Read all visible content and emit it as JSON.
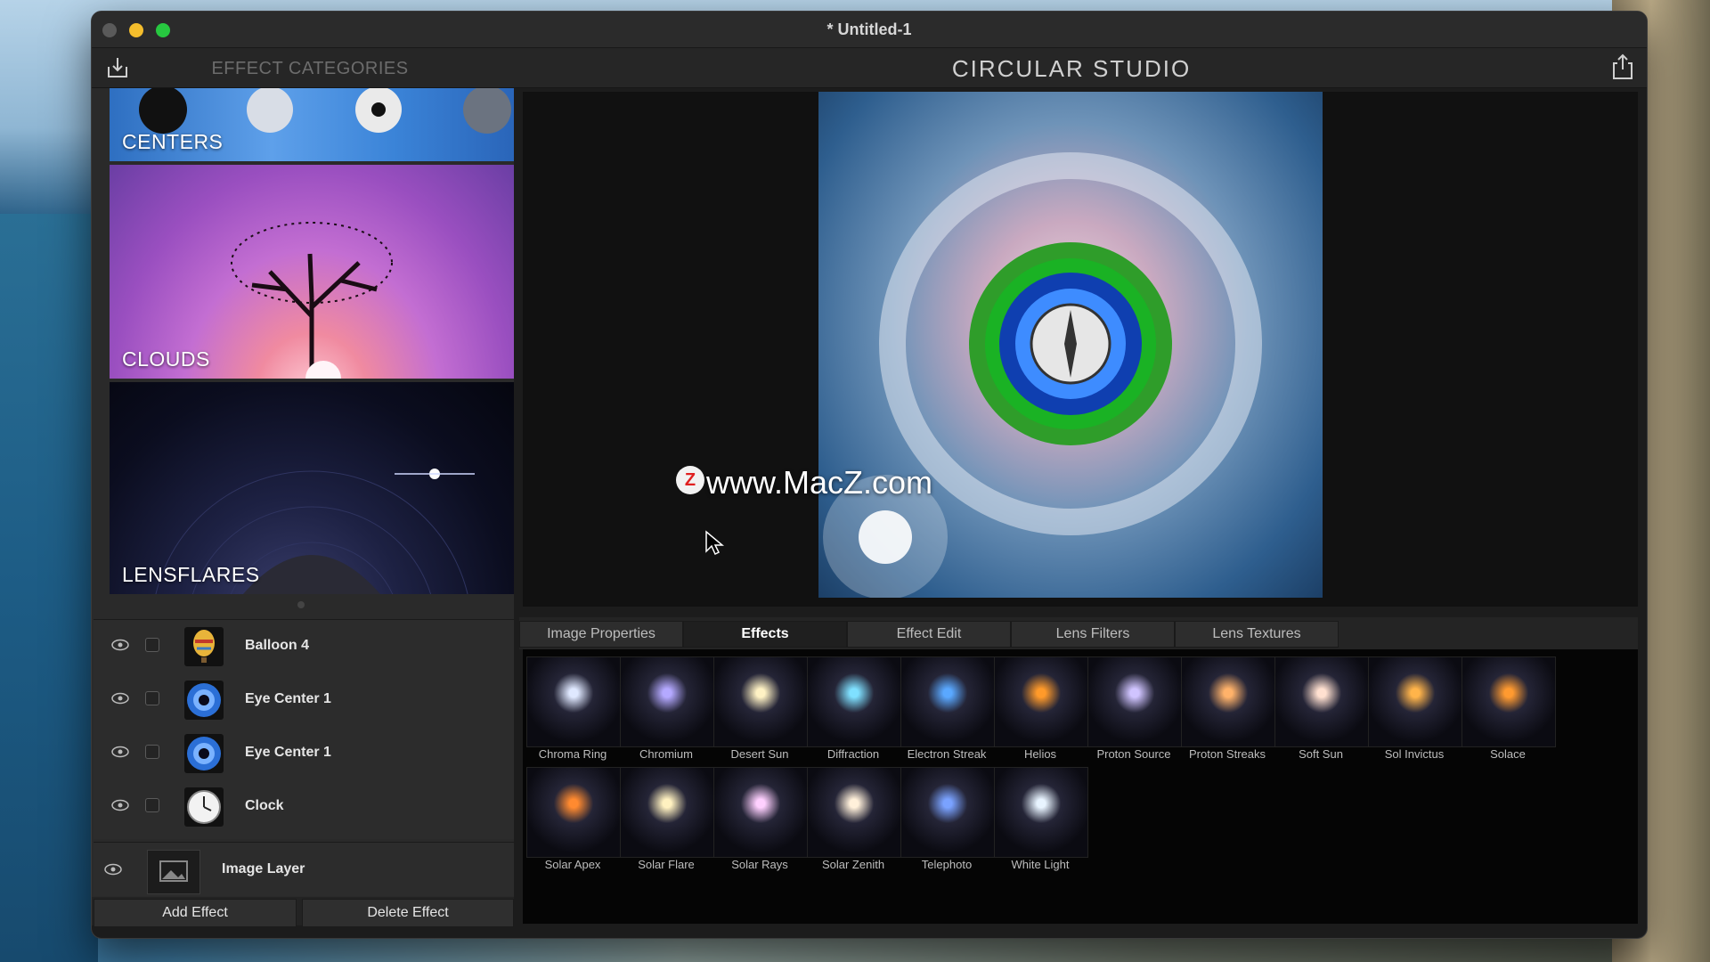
{
  "window": {
    "title": "* Untitled-1"
  },
  "toolbar": {
    "categories_title": "EFFECT CATEGORIES",
    "app_title": "CIRCULAR STUDIO"
  },
  "categories": [
    {
      "label": "CENTERS"
    },
    {
      "label": "CLOUDS"
    },
    {
      "label": "LENSFLARES"
    }
  ],
  "layers": [
    {
      "name": "Balloon 4",
      "thumb_icon": "balloon-icon"
    },
    {
      "name": "Eye Center 1",
      "thumb_icon": "eye-center-icon"
    },
    {
      "name": "Eye Center 1",
      "thumb_icon": "eye-center-icon"
    },
    {
      "name": "Clock",
      "thumb_icon": "clock-icon"
    }
  ],
  "image_layer": {
    "name": "Image Layer"
  },
  "buttons": {
    "add": "Add Effect",
    "delete": "Delete Effect"
  },
  "watermark": {
    "logo": "Z",
    "text": "www.MacZ.com"
  },
  "tabs": [
    {
      "label": "Image Properties",
      "active": false
    },
    {
      "label": "Effects",
      "active": true
    },
    {
      "label": "Effect Edit",
      "active": false
    },
    {
      "label": "Lens Filters",
      "active": false
    },
    {
      "label": "Lens Textures",
      "active": false
    }
  ],
  "effects": [
    {
      "label": "Chroma Ring",
      "color": "#dfe8ff"
    },
    {
      "label": "Chromium",
      "color": "#b4a9ff"
    },
    {
      "label": "Desert Sun",
      "color": "#fff2c4"
    },
    {
      "label": "Diffraction",
      "color": "#7fe0ff"
    },
    {
      "label": "Electron Streak",
      "color": "#5aa8ff"
    },
    {
      "label": "Helios",
      "color": "#ff9a2a"
    },
    {
      "label": "Proton Source",
      "color": "#d0c4ff"
    },
    {
      "label": "Proton Streaks",
      "color": "#ffb26a"
    },
    {
      "label": "Soft Sun",
      "color": "#ffe0d0"
    },
    {
      "label": "Sol Invictus",
      "color": "#ffb44a"
    },
    {
      "label": "Solace",
      "color": "#ff9a30"
    },
    {
      "label": "Solar Apex",
      "color": "#ff8a30"
    },
    {
      "label": "Solar Flare",
      "color": "#fff1c0"
    },
    {
      "label": "Solar Rays",
      "color": "#ffd0ff"
    },
    {
      "label": "Solar Zenith",
      "color": "#fff0da"
    },
    {
      "label": "Telephoto",
      "color": "#7aa2ff"
    },
    {
      "label": "White Light",
      "color": "#e8f4ff"
    }
  ]
}
